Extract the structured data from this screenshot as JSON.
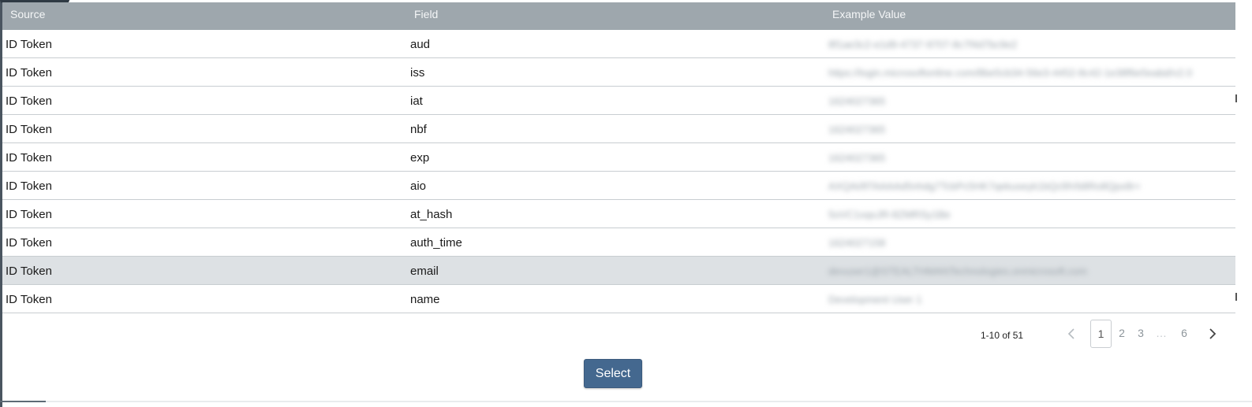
{
  "table": {
    "headers": {
      "source": "Source",
      "field": "Field",
      "example": "Example Value"
    },
    "rows": [
      {
        "source": "ID Token",
        "field": "aud",
        "example": "8f1ae3c2-e1d9-4737-9707-8c7f4d7bc9e2"
      },
      {
        "source": "ID Token",
        "field": "iss",
        "example": "https://login.microsoftonline.com/8be5cb34-56e3-4452-8c42-1e38f6e5eabd/v2.0"
      },
      {
        "source": "ID Token",
        "field": "iat",
        "example": "1624027365"
      },
      {
        "source": "ID Token",
        "field": "nbf",
        "example": "1624027365"
      },
      {
        "source": "ID Token",
        "field": "exp",
        "example": "1624027365"
      },
      {
        "source": "ID Token",
        "field": "aio",
        "example": "AXQAi/8TAAAAd5nhdg7TcbPc5HK7qekuseyk1bQcl9Vb8Ro8Qpx8r+"
      },
      {
        "source": "ID Token",
        "field": "at_hash",
        "example": "5oVC1xqoJR-8ZMRSy1Be"
      },
      {
        "source": "ID Token",
        "field": "auth_time",
        "example": "1624027158"
      },
      {
        "source": "ID Token",
        "field": "email",
        "example": "devuser1@STEALTHMANTechnologies.onmicrosoft.com"
      },
      {
        "source": "ID Token",
        "field": "name",
        "example": "Development User 1"
      }
    ],
    "highlighted_row": 8
  },
  "pagination": {
    "count_text": "1-10 of 51",
    "pages": [
      "1",
      "2",
      "3",
      "…",
      "6"
    ],
    "current": "1",
    "prev_icon": "chevron-left-icon",
    "next_icon": "chevron-right-icon"
  },
  "actions": {
    "select_label": "Select"
  },
  "colors": {
    "header_bg": "#9ea7ad",
    "highlight_row": "#dde1e4",
    "button_bg": "#44688f"
  }
}
